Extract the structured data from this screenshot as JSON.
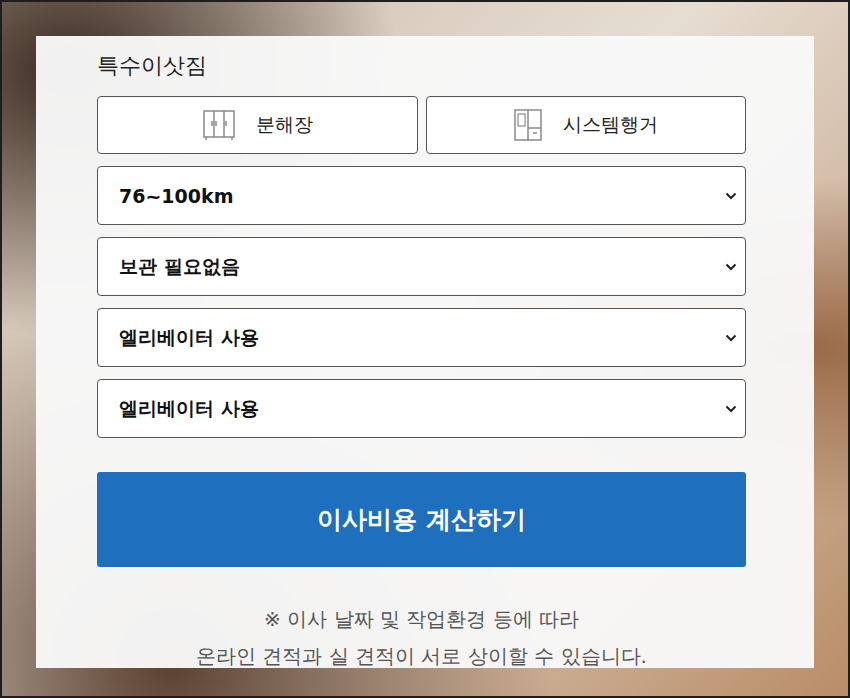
{
  "section_label": "특수이삿짐",
  "special_items": [
    {
      "label": "분해장",
      "kind": "wardrobe",
      "selected": false
    },
    {
      "label": "시스템행거",
      "kind": "hanger",
      "selected": false
    }
  ],
  "selects": [
    {
      "value": "76~100km"
    },
    {
      "value": "보관 필요없음"
    },
    {
      "value": "엘리베이터 사용"
    },
    {
      "value": "엘리베이터 사용"
    }
  ],
  "submit_button": "이사비용 계산하기",
  "notice": [
    "※ 이사 날짜 및 작업환경 등에 따라",
    "온라인 견적과 실 견적이 서로 상이할 수 있습니다."
  ]
}
